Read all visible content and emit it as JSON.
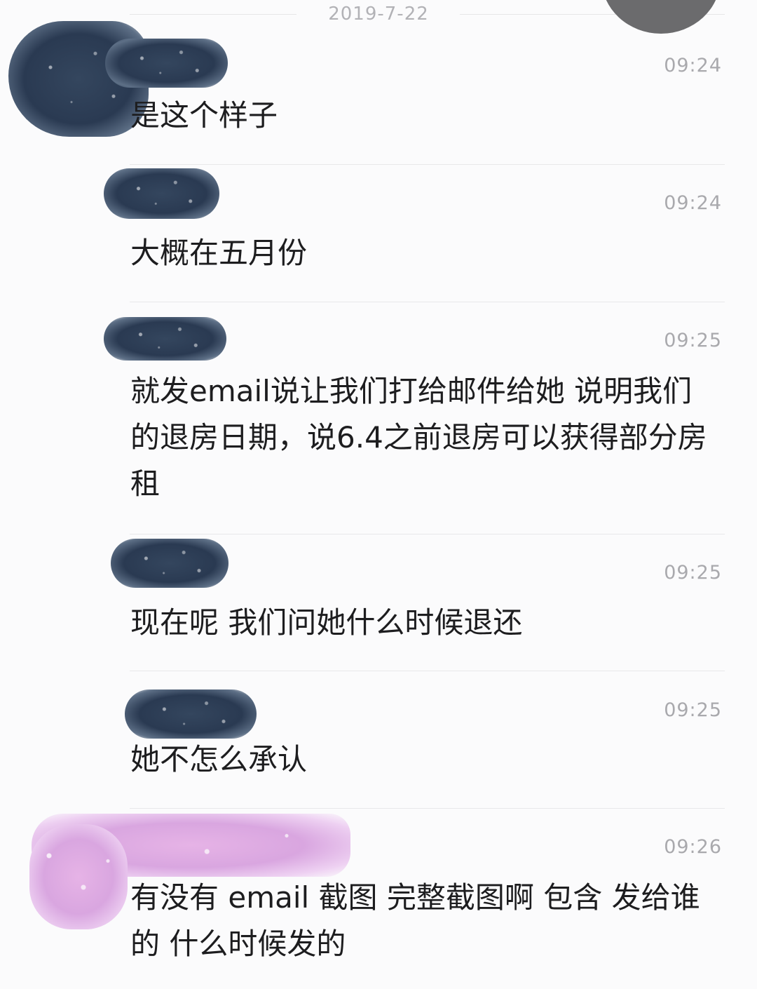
{
  "date_separator": "2019-7-22",
  "messages": [
    {
      "time": "09:24",
      "text": "是这个样子"
    },
    {
      "time": "09:24",
      "text": "大概在五月份"
    },
    {
      "time": "09:25",
      "text": "就发email说让我们打给邮件给她 说明我们的退房日期，说6.4之前退房可以获得部分房租"
    },
    {
      "time": "09:25",
      "text": "现在呢 我们问她什么时候退还"
    },
    {
      "time": "09:25",
      "text": "她不怎么承认"
    },
    {
      "time": "09:26",
      "text": "有没有 email 截图  完整截图啊 包含 发给谁的 什么时候发的"
    }
  ],
  "colors": {
    "background": "#fbfbfc",
    "timestamp": "#a9a9ad",
    "message_text": "#1d1d1f",
    "divider": "#e8e8ea",
    "redaction_dark": "#2a3a52",
    "redaction_pink": "#e6b3e6"
  }
}
